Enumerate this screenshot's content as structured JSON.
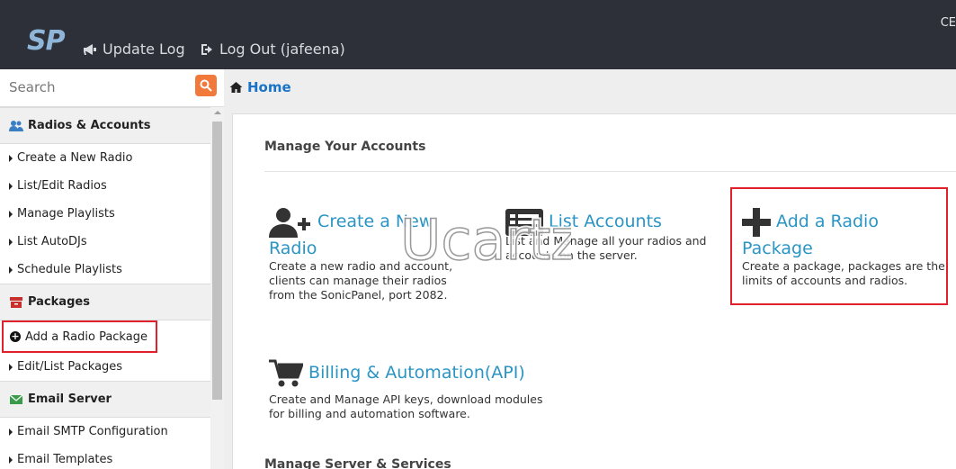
{
  "topbar": {
    "logo_text": "SP",
    "update_log": "Update Log",
    "log_out": "Log Out (jafeena)",
    "right_text": "CE"
  },
  "search": {
    "placeholder": "Search"
  },
  "sidebar": {
    "sections": [
      {
        "header": "Radios & Accounts",
        "icon": "users-icon",
        "items": [
          "Create a New Radio",
          "List/Edit Radios",
          "Manage Playlists",
          "List AutoDJs",
          "Schedule Playlists"
        ]
      },
      {
        "header": "Packages",
        "icon": "archive-icon",
        "items": [
          "Add a Radio Package",
          "Edit/List Packages"
        ]
      },
      {
        "header": "Email Server",
        "icon": "envelope-icon",
        "items": [
          "Email SMTP Configuration",
          "Email Templates"
        ]
      }
    ]
  },
  "breadcrumb": {
    "home": "Home"
  },
  "main": {
    "section_title": "Manage Your Accounts",
    "section_title_2": "Manage Server & Services",
    "cards": {
      "create": {
        "title_1": "Create a New",
        "title_2": "Radio",
        "desc": "Create a new radio and account, clients can manage their radios from the SonicPanel, port 2082."
      },
      "list": {
        "title": "List Accounts",
        "desc": "List and Manage all your radios and accounts on the server."
      },
      "add": {
        "title_1": "Add a Radio",
        "title_2": "Package",
        "desc": "Create a package, packages are the limits of accounts and radios."
      },
      "billing": {
        "title": "Billing & Automation(API)",
        "desc": "Create and Manage API keys, download modules for billing and automation software."
      }
    }
  },
  "watermark": {
    "text": "Ucartz"
  },
  "colors": {
    "topbar": "#2d3038",
    "accent_blue": "#2a95c5",
    "highlight_red": "#e0202a",
    "search_orange": "#f0793b"
  }
}
